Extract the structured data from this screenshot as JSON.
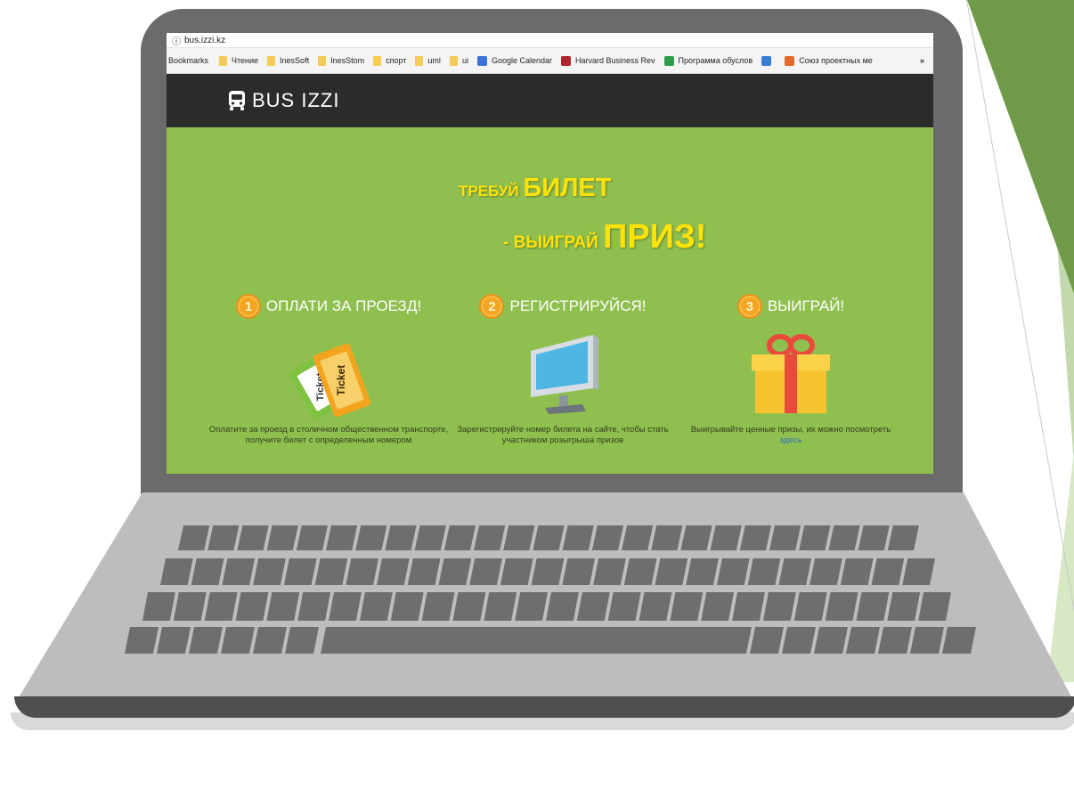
{
  "browser": {
    "url": "bus.izzi.kz",
    "bookmarks_label": "Bookmarks",
    "bookmarks": [
      {
        "label": "Чтение",
        "icon": "folder-icon"
      },
      {
        "label": "InesSoft",
        "icon": "folder-icon"
      },
      {
        "label": "InesStom",
        "icon": "folder-icon"
      },
      {
        "label": "спорт",
        "icon": "folder-icon"
      },
      {
        "label": "uml",
        "icon": "folder-icon"
      },
      {
        "label": "ui",
        "icon": "folder-icon"
      },
      {
        "label": "Google Calendar",
        "icon": "calendar-icon"
      },
      {
        "label": "Harvard Business Rev",
        "icon": "hbr-icon"
      },
      {
        "label": "Программа обуслов",
        "icon": "diamond-icon"
      },
      {
        "label": "",
        "icon": "globe-icon"
      },
      {
        "label": "Союз проектных ме",
        "icon": "union-icon"
      }
    ],
    "more": "»"
  },
  "site": {
    "logo_text": "BUS IZZI",
    "headline": {
      "line1_small": "ТРЕБУЙ ",
      "line1_big": "БИЛЕТ",
      "line2_small": "- ВЫИГРАЙ ",
      "line2_big": "ПРИЗ!"
    },
    "steps": [
      {
        "number": "1",
        "title": "ОПЛАТИ ЗА ПРОЕЗД!",
        "image": "ticket-icon",
        "description": "Оплатите за проезд в столичном общественном транспорте, получите билет с определенным номером",
        "link": ""
      },
      {
        "number": "2",
        "title": "РЕГИСТРИРУЙСЯ!",
        "image": "monitor-icon",
        "description": "Зарегистрируйте номер билета на сайте, чтобы стать участником розыгрыша призов",
        "link": ""
      },
      {
        "number": "3",
        "title": "ВЫИГРАЙ!",
        "image": "gift-icon",
        "description": "Выигрывайте ценные призы, их можно посмотреть",
        "link": "здесь"
      }
    ],
    "ticket_word": "Ticket"
  },
  "colors": {
    "site_green": "#8fbf4f",
    "header_dark": "#2b2b2b",
    "headline_yellow": "#ffe20a",
    "laptop_lid": "#6b6b6b",
    "laptop_base": "#bdbdbd",
    "key": "#6e6e6e"
  }
}
